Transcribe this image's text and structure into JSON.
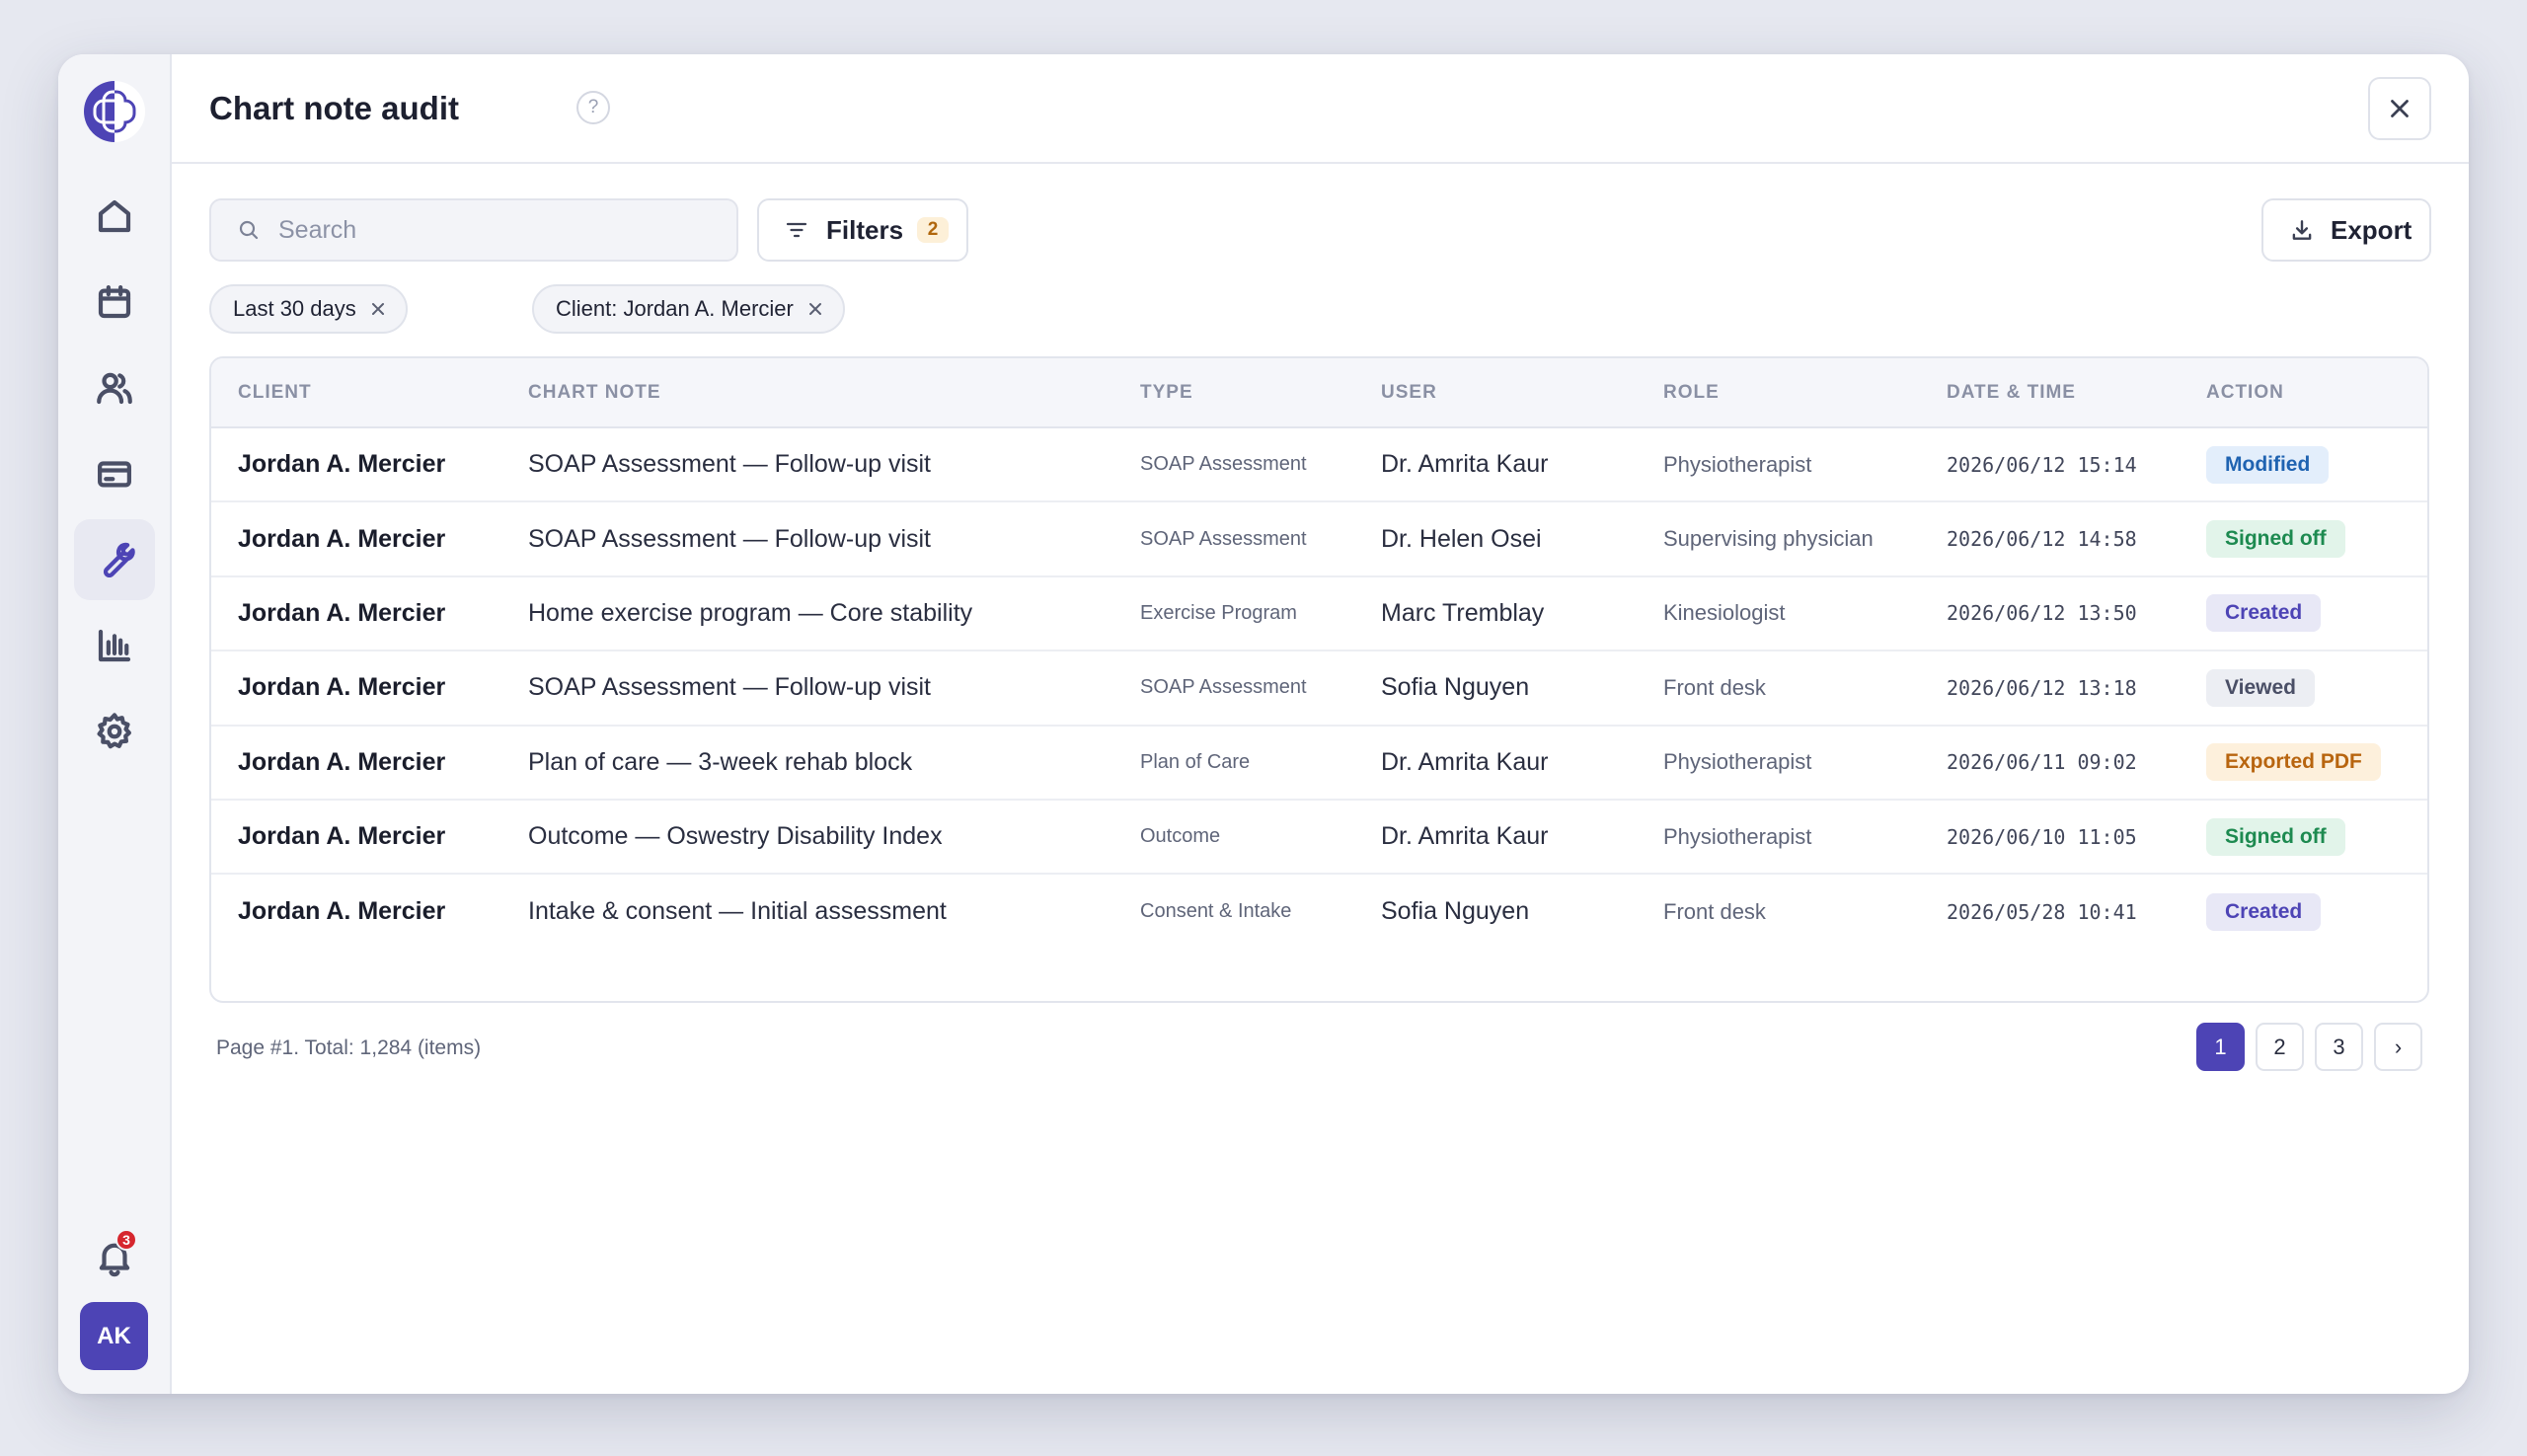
{
  "app": {
    "title": "Chart note audit",
    "help_glyph": "?",
    "accent_color": "#4d44b5"
  },
  "sidebar": {
    "items": [
      {
        "icon": "home-icon",
        "active": false
      },
      {
        "icon": "calendar-icon",
        "active": false
      },
      {
        "icon": "users-icon",
        "active": false
      },
      {
        "icon": "billing-card-icon",
        "active": false
      },
      {
        "icon": "wrench-icon",
        "active": true
      },
      {
        "icon": "bar-chart-icon",
        "active": false
      },
      {
        "icon": "gear-icon",
        "active": false
      }
    ],
    "notifications_count": "3",
    "user_initials": "AK"
  },
  "toolbar": {
    "search_placeholder": "Search",
    "search_value": "",
    "filters_label": "Filters",
    "filters_count": "2",
    "export_label": "Export"
  },
  "chips": [
    {
      "label": "Last 30 days"
    },
    {
      "label": "Client: Jordan A. Mercier"
    }
  ],
  "table": {
    "columns": [
      "CLIENT",
      "CHART NOTE",
      "TYPE",
      "USER",
      "ROLE",
      "DATE & TIME",
      "ACTION"
    ],
    "rows": [
      {
        "client": "Jordan A. Mercier",
        "note": "SOAP Assessment — Follow-up visit",
        "type": "SOAP Assessment",
        "user": "Dr. Amrita Kaur",
        "role": "Physiotherapist",
        "datetime": "2026/06/12 15:14",
        "action": "Modified"
      },
      {
        "client": "Jordan A. Mercier",
        "note": "SOAP Assessment — Follow-up visit",
        "type": "SOAP Assessment",
        "user": "Dr. Helen Osei",
        "role": "Supervising physician",
        "datetime": "2026/06/12 14:58",
        "action": "Signed off"
      },
      {
        "client": "Jordan A. Mercier",
        "note": "Home exercise program — Core stability",
        "type": "Exercise Program",
        "user": "Marc Tremblay",
        "role": "Kinesiologist",
        "datetime": "2026/06/12 13:50",
        "action": "Created"
      },
      {
        "client": "Jordan A. Mercier",
        "note": "SOAP Assessment — Follow-up visit",
        "type": "SOAP Assessment",
        "user": "Sofia Nguyen",
        "role": "Front desk",
        "datetime": "2026/06/12 13:18",
        "action": "Viewed"
      },
      {
        "client": "Jordan A. Mercier",
        "note": "Plan of care — 3-week rehab block",
        "type": "Plan of Care",
        "user": "Dr. Amrita Kaur",
        "role": "Physiotherapist",
        "datetime": "2026/06/11 09:02",
        "action": "Exported PDF"
      },
      {
        "client": "Jordan A. Mercier",
        "note": "Outcome — Oswestry Disability Index",
        "type": "Outcome",
        "user": "Dr. Amrita Kaur",
        "role": "Physiotherapist",
        "datetime": "2026/06/10 11:05",
        "action": "Signed off"
      },
      {
        "client": "Jordan A. Mercier",
        "note": "Intake & consent — Initial assessment",
        "type": "Consent & Intake",
        "user": "Sofia Nguyen",
        "role": "Front desk",
        "datetime": "2026/05/28 10:41",
        "action": "Created"
      }
    ]
  },
  "pagination": {
    "info": "Page #1. Total: 1,284 (items)",
    "pages": [
      "1",
      "2",
      "3"
    ],
    "current": "1",
    "next_glyph": "›"
  }
}
